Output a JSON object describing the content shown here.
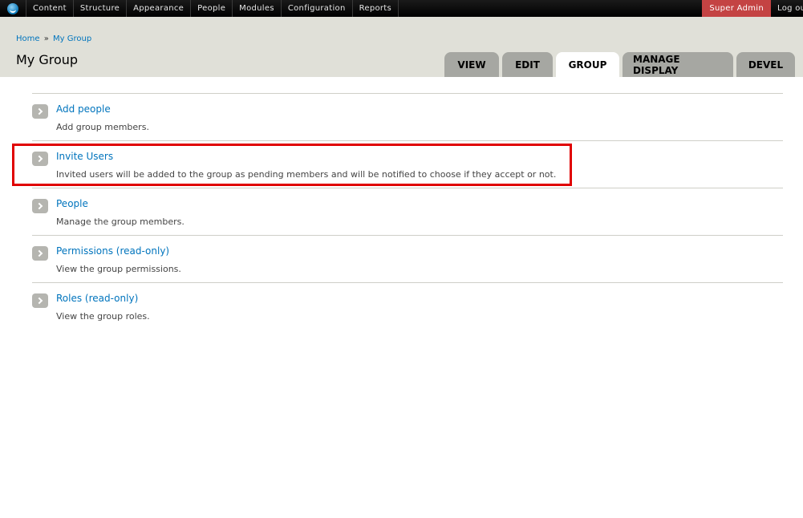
{
  "toolbar": {
    "menu": [
      "Content",
      "Structure",
      "Appearance",
      "People",
      "Modules",
      "Configuration",
      "Reports"
    ],
    "user": "Super Admin",
    "logout": "Log out"
  },
  "breadcrumb": {
    "home": "Home",
    "separator": "»",
    "current": "My Group"
  },
  "page_title": "My Group",
  "tabs": [
    "VIEW",
    "EDIT",
    "GROUP",
    "MANAGE DISPLAY",
    "DEVEL"
  ],
  "active_tab": "GROUP",
  "items": [
    {
      "title": "Add people",
      "description": "Add group members."
    },
    {
      "title": "Invite Users",
      "description": "Invited users will be added to the group as pending members and will be notified to choose if they accept or not."
    },
    {
      "title": "People",
      "description": "Manage the group members."
    },
    {
      "title": "Permissions (read-only)",
      "description": "View the group permissions."
    },
    {
      "title": "Roles (read-only)",
      "description": "View the group roles."
    }
  ],
  "colors": {
    "toolbar": "#000000",
    "user_badge": "#c44343",
    "link": "#0074bd",
    "header": "#e0e0d8",
    "highlight": "#e00000"
  }
}
